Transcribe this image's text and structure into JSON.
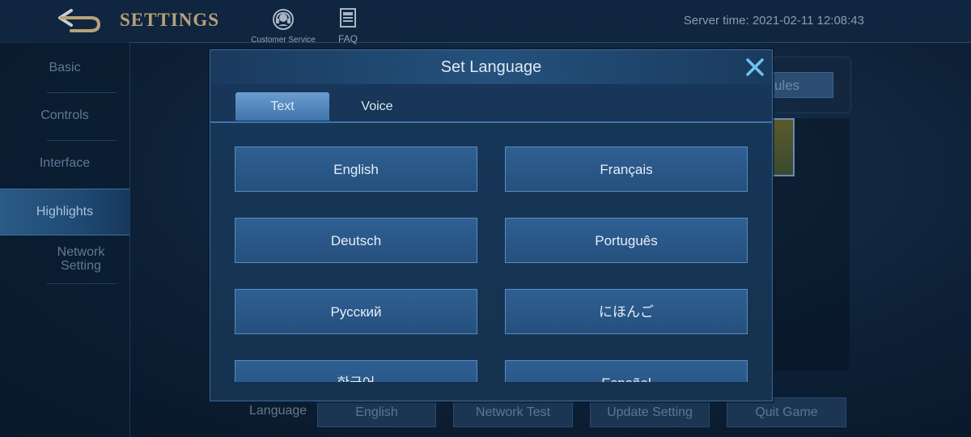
{
  "header": {
    "title": "SETTINGS",
    "customer_service": "Customer Service",
    "faq": "FAQ",
    "server_time": "Server time: 2021-02-11 12:08:43"
  },
  "sidebar": {
    "items": [
      {
        "label": "Basic"
      },
      {
        "label": "Controls"
      },
      {
        "label": "Interface"
      },
      {
        "label": "Highlights"
      },
      {
        "label": "Network Setting"
      }
    ],
    "active_index": 3
  },
  "background": {
    "rules_fragment": "ules"
  },
  "bottom": {
    "language_label": "Language",
    "language_value": "English",
    "network_test": "Network Test",
    "update_setting": "Update Setting",
    "quit_game": "Quit Game"
  },
  "modal": {
    "title": "Set Language",
    "tabs": [
      {
        "label": "Text",
        "active": true
      },
      {
        "label": "Voice",
        "active": false
      }
    ],
    "languages": [
      {
        "label": "English"
      },
      {
        "label": "Français"
      },
      {
        "label": "Deutsch"
      },
      {
        "label": "Português"
      },
      {
        "label": "Русский"
      },
      {
        "label": "にほんご"
      },
      {
        "label": "한국어"
      },
      {
        "label": "Español"
      }
    ]
  },
  "colors": {
    "accent": "#3f74aa",
    "close_icon": "#6ec3f0",
    "title_gold": "#b8a27a"
  }
}
